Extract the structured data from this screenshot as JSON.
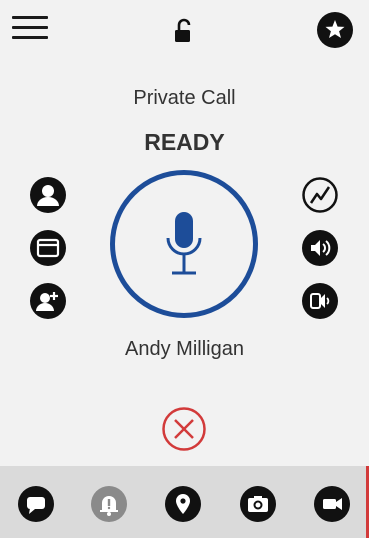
{
  "header": {
    "menu_icon": "hamburger-menu-icon",
    "lock_icon": "unlocked-padlock-icon",
    "favorite_icon": "star-icon"
  },
  "call": {
    "type": "Private Call",
    "status": "READY",
    "callee": "Andy Milligan"
  },
  "left_actions": [
    {
      "icon": "contact-icon"
    },
    {
      "icon": "folder-icon"
    },
    {
      "icon": "add-contact-icon"
    }
  ],
  "right_actions": [
    {
      "icon": "signal-icon"
    },
    {
      "icon": "speaker-icon"
    },
    {
      "icon": "earpiece-icon"
    }
  ],
  "ptt": {
    "icon": "microphone-icon"
  },
  "end_call": {
    "icon": "close-circle-icon"
  },
  "bottom_toolbar": [
    {
      "icon": "message-icon"
    },
    {
      "icon": "alert-bell-icon"
    },
    {
      "icon": "location-pin-icon"
    },
    {
      "icon": "camera-icon"
    },
    {
      "icon": "video-icon"
    }
  ],
  "colors": {
    "background": "#f2f2f2",
    "accent": "#1d4d99",
    "end_call": "#d23a3a",
    "toolbar": "#dadada",
    "disabled_icon": "#8a8a8a"
  }
}
